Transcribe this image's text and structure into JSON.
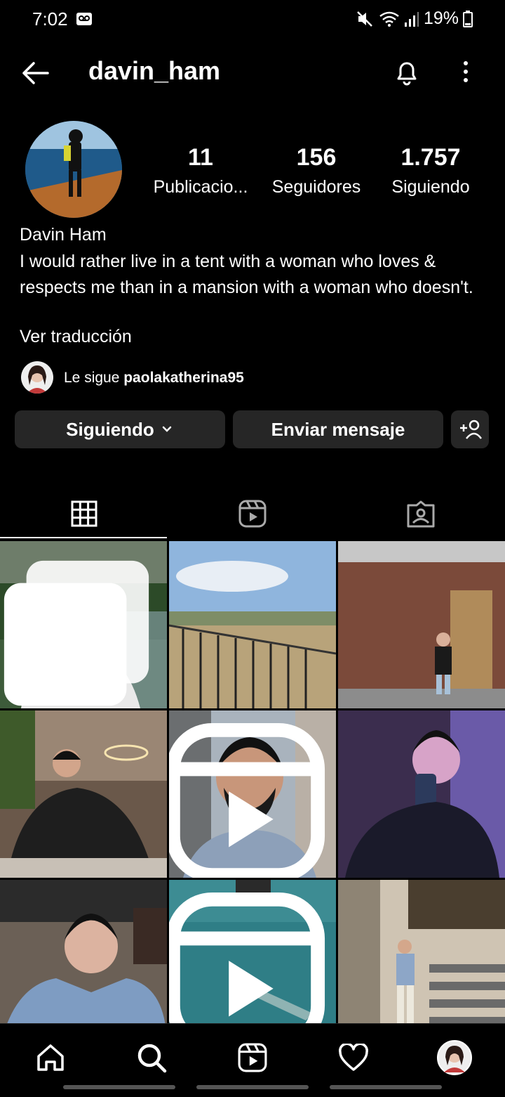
{
  "status": {
    "time": "7:02",
    "battery": "19%"
  },
  "header": {
    "username": "davin_ham"
  },
  "profile": {
    "stats": [
      {
        "value": "11",
        "label": "Publicacio..."
      },
      {
        "value": "156",
        "label": "Seguidores"
      },
      {
        "value": "1.757",
        "label": "Siguiendo"
      }
    ],
    "name": "Davin Ham",
    "bio": "I would rather live in a tent with a woman who loves & respects me than in a mansion with a woman who doesn't.",
    "translate_link": "Ver traducción",
    "followed_by_prefix": "Le sigue ",
    "followed_by_user": "paolakatherina95"
  },
  "actions": {
    "following_label": "Siguiendo",
    "message_label": "Enviar mensaje"
  },
  "tabs": [
    {
      "icon": "grid-icon",
      "active": true
    },
    {
      "icon": "reels-icon",
      "active": false
    },
    {
      "icon": "tagged-icon",
      "active": false
    }
  ],
  "grid": {
    "posts": [
      {
        "badge": "carousel-icon",
        "description": "man in white sweater on balcony"
      },
      {
        "badge": null,
        "description": "balcony view of field"
      },
      {
        "badge": null,
        "description": "man in front of brick building"
      },
      {
        "badge": null,
        "description": "man in black jacket in restaurant"
      },
      {
        "badge": "reels-icon",
        "description": "man with black face mask selfie"
      },
      {
        "badge": null,
        "description": "mirror selfie purple light"
      },
      {
        "badge": null,
        "description": "man in denim jacket in car"
      },
      {
        "badge": "reels-icon",
        "description": "shark in sea water"
      },
      {
        "badge": null,
        "description": "man on stairs"
      }
    ]
  },
  "bottom_nav": [
    "home-icon",
    "search-icon",
    "reels-icon",
    "heart-icon",
    "profile-avatar"
  ]
}
